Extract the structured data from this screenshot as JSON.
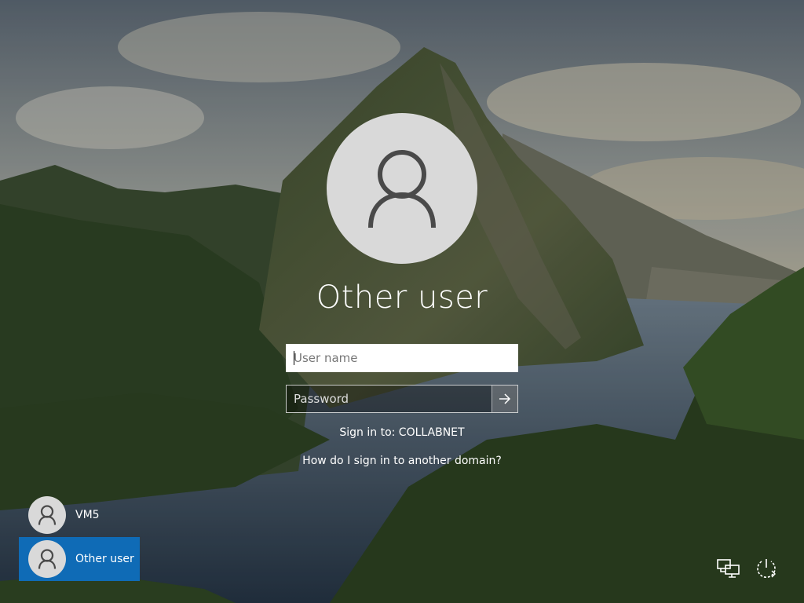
{
  "login": {
    "title": "Other user",
    "username_placeholder": "User name",
    "username_value": "",
    "password_placeholder": "Password",
    "password_value": "",
    "sign_in_to": "Sign in to: COLLABNET",
    "domain_help_link": "How do I sign in to another domain?"
  },
  "users": [
    {
      "label": "VM5",
      "selected": false
    },
    {
      "label": "Other user",
      "selected": true
    }
  ],
  "icons": {
    "network": "network-icon",
    "power": "power-icon",
    "submit": "arrow-right-icon",
    "avatar": "user-silhouette-icon"
  },
  "colors": {
    "selected_tile": "#0f6bb6",
    "avatar_bg": "#d9d9d9",
    "avatar_glyph": "#4a4a4a"
  }
}
